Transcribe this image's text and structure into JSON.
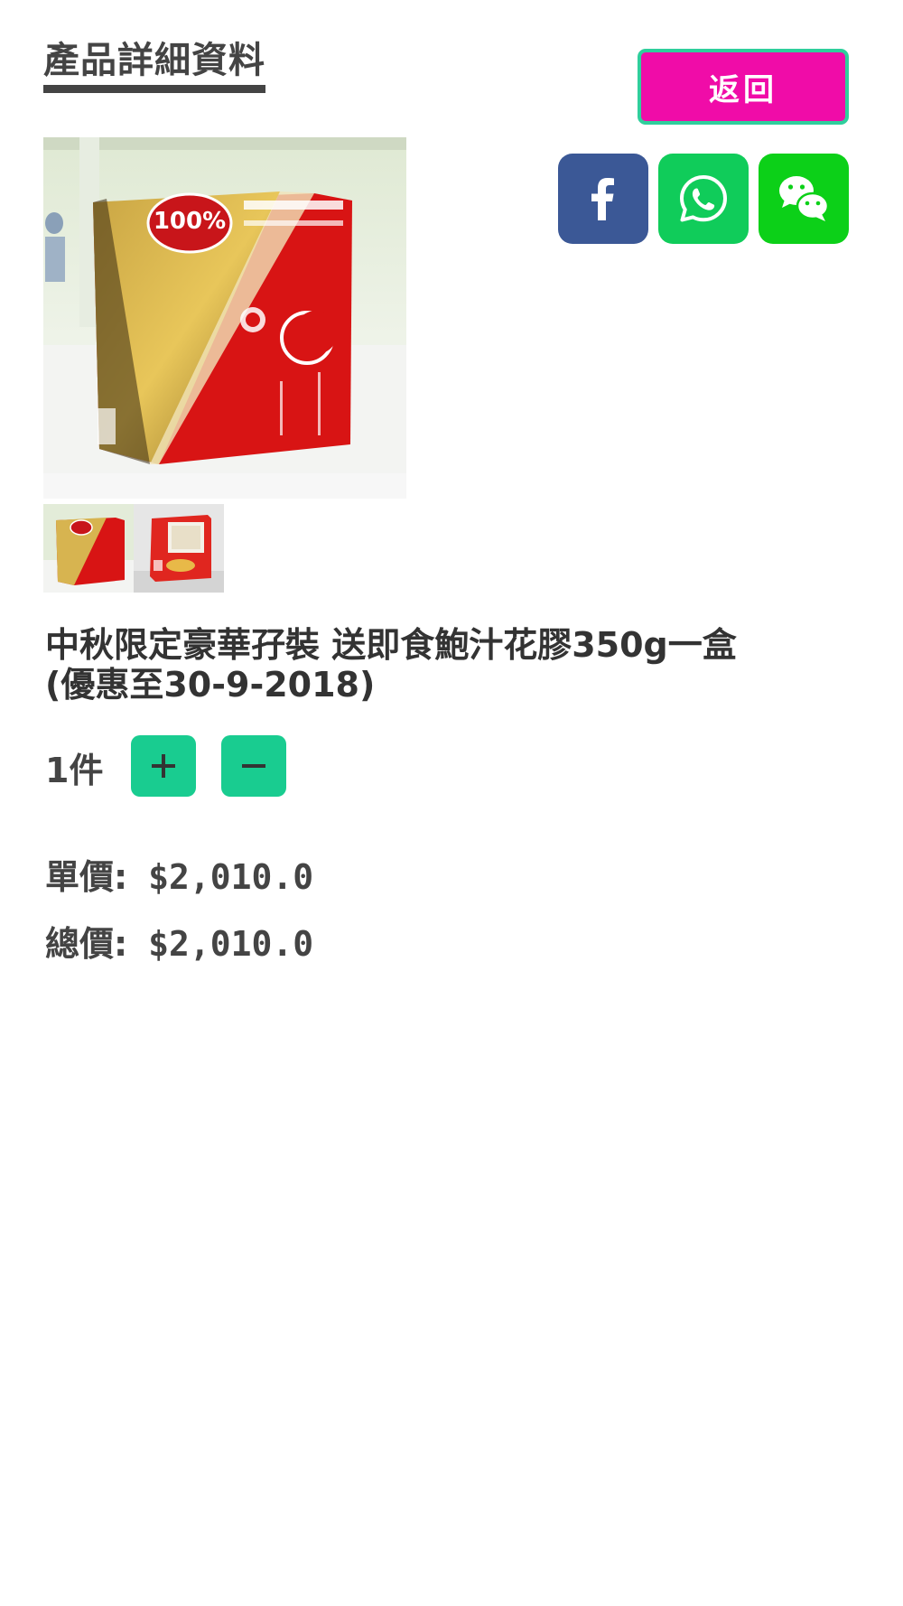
{
  "header": {
    "title": "產品詳細資料",
    "back_label": "返回"
  },
  "share": {
    "items": [
      {
        "name": "facebook",
        "icon": "facebook-icon",
        "color": "#3b5896"
      },
      {
        "name": "whatsapp",
        "icon": "whatsapp-icon",
        "color": "#10cc5a"
      },
      {
        "name": "wechat",
        "icon": "wechat-icon",
        "color": "#0cd018"
      }
    ]
  },
  "product": {
    "name": "中秋限定豪華孖裝 送即食鮑汁花膠350g一盒\n(優惠至30-9-2018)",
    "badge_text": "100%"
  },
  "quantity": {
    "text": "1件",
    "plus_icon": "plus-icon",
    "minus_icon": "minus-icon",
    "button_color": "#19cc90"
  },
  "pricing": {
    "unit_label": "單價:",
    "unit_value": "$2,010.0",
    "total_label": "總價:",
    "total_value": "$2,010.0"
  },
  "colors": {
    "back_button": "#f00ca8",
    "back_button_border": "#2fcf9c"
  }
}
